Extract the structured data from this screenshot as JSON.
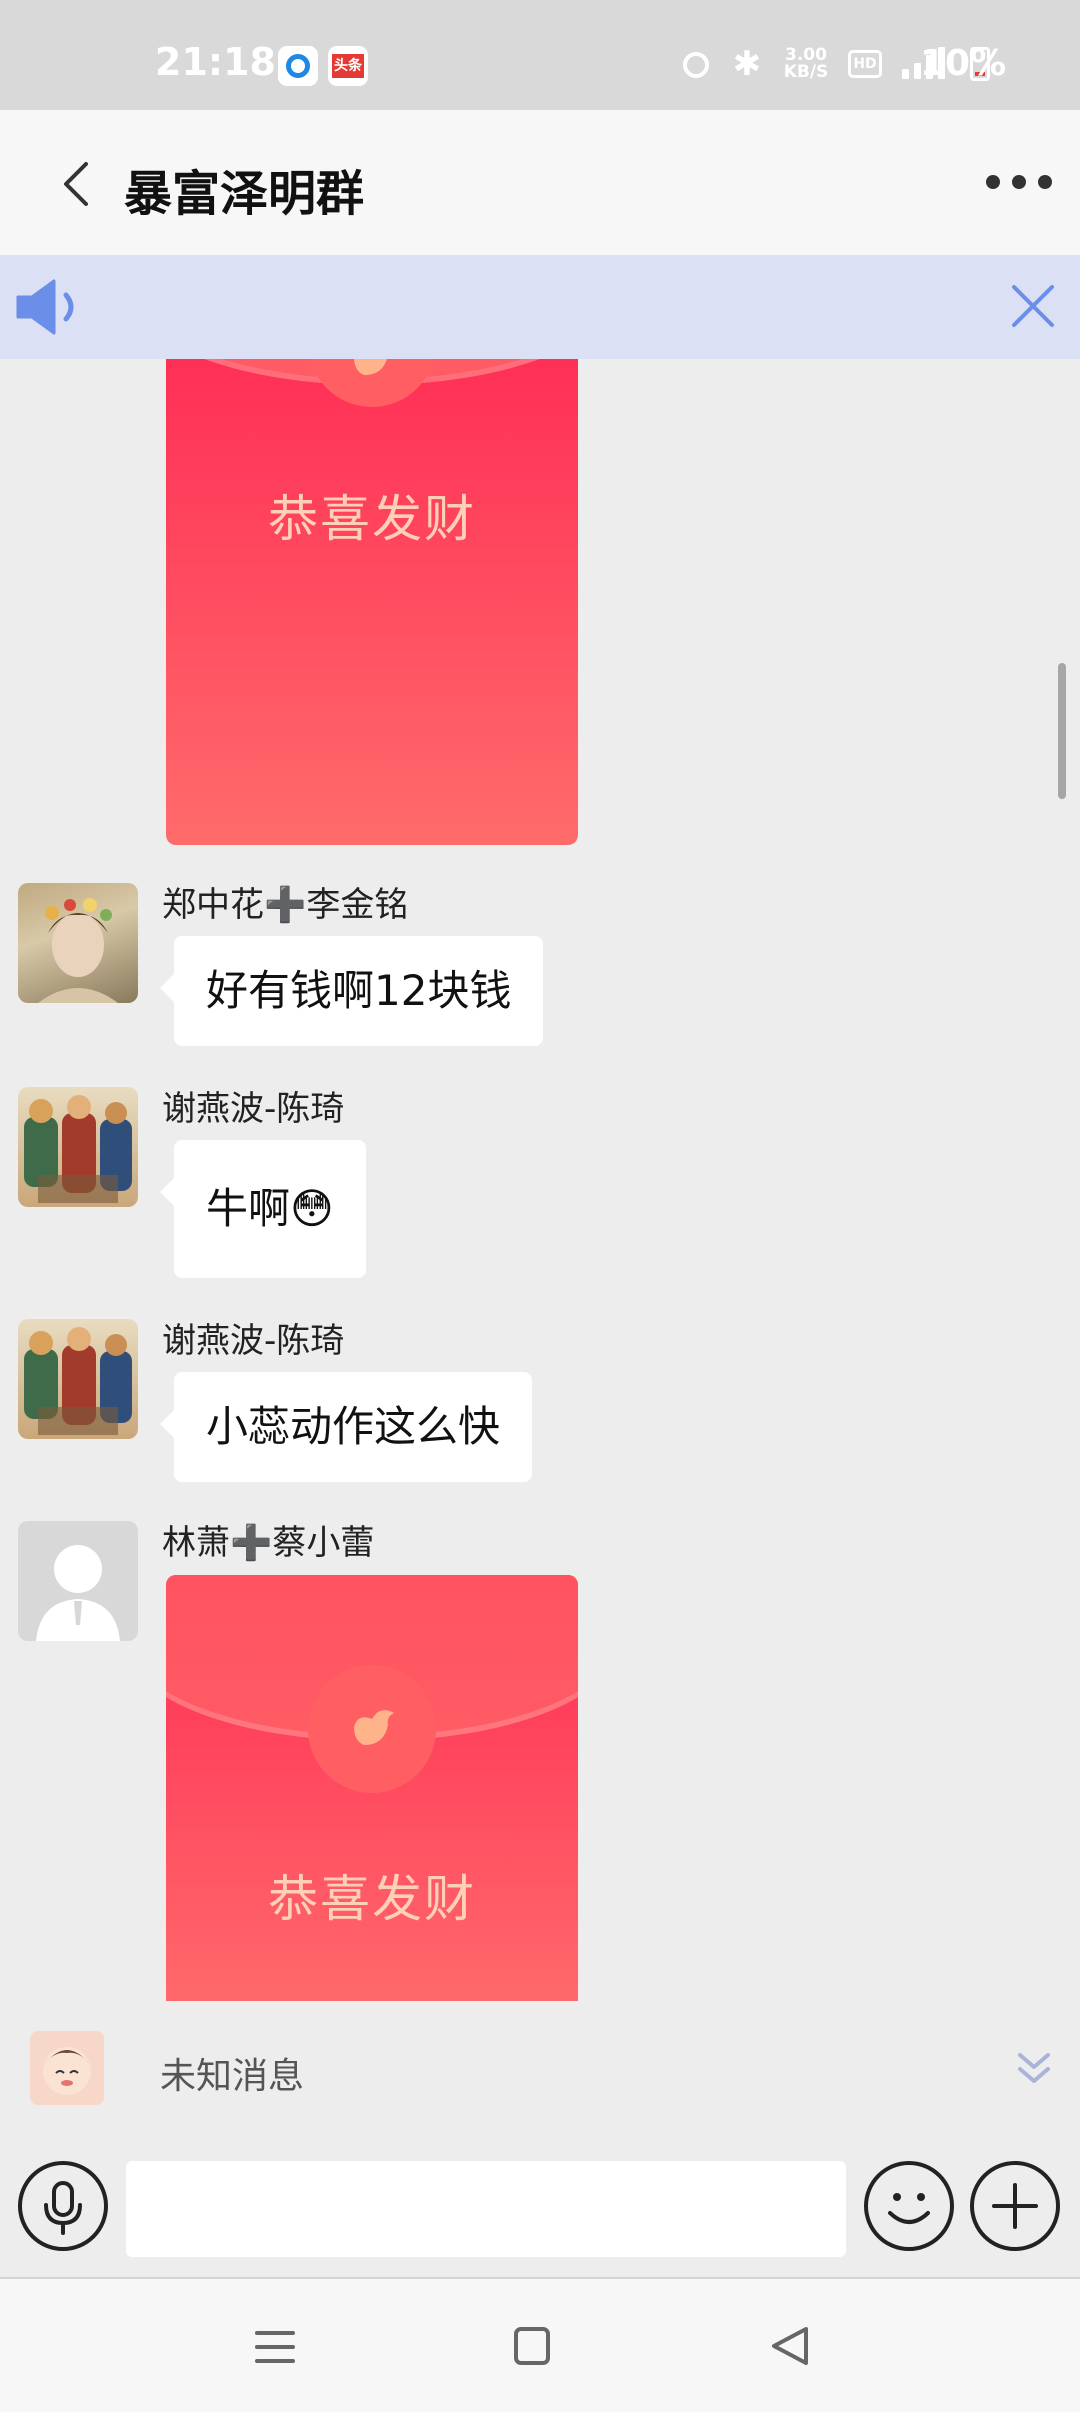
{
  "status_bar": {
    "time": "21:18",
    "app_badge_2": "头条",
    "net_speed": "3.00",
    "net_speed_unit": "KB/S",
    "hd_label": "HD",
    "network_type": "4G",
    "battery_percent": "10%"
  },
  "header": {
    "title": "暴富泽明群"
  },
  "messages": [
    {
      "type": "red_packet",
      "caption": "恭喜发财"
    },
    {
      "type": "text",
      "sender": "郑中花➕李金铭",
      "text": "好有钱啊12块钱"
    },
    {
      "type": "text",
      "sender": "谢燕波-陈琦",
      "text": "牛啊😳"
    },
    {
      "type": "text",
      "sender": "谢燕波-陈琦",
      "text": "小蕊动作这么快"
    },
    {
      "type": "red_packet",
      "sender": "林萧➕蔡小蕾",
      "caption": "恭喜发财"
    }
  ],
  "unknown_bar": {
    "text": "未知消息"
  },
  "input": {
    "placeholder": ""
  },
  "icons": {
    "back": "chevron-left-icon",
    "more": "more-dots-icon",
    "speaker": "speaker-icon",
    "close": "close-icon",
    "voice": "microphone-icon",
    "emoji": "smiley-icon",
    "plus": "plus-icon",
    "nav_menu": "menu-icon",
    "nav_home": "home-icon",
    "nav_back": "back-triangle-icon"
  },
  "colors": {
    "red_packet": "#ff2d55",
    "banner": "#dbe0f4",
    "accent_blue": "#6b8ee8"
  }
}
